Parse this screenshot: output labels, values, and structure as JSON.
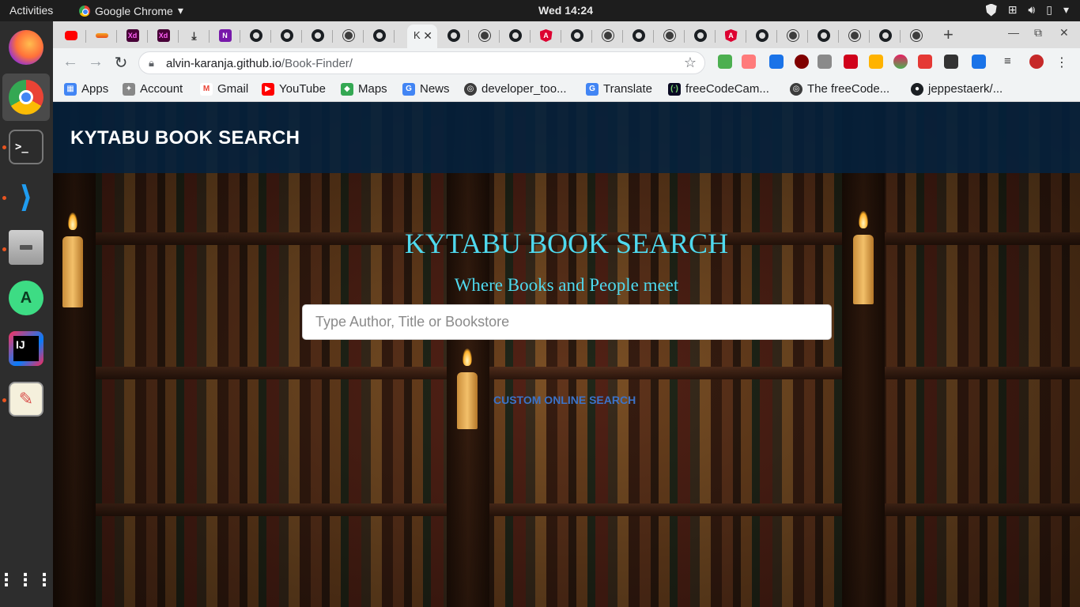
{
  "topbar": {
    "activities": "Activities",
    "app_name": "Google Chrome",
    "clock": "Wed 14:24"
  },
  "dock": {
    "apps": [
      "firefox",
      "chrome",
      "terminal",
      "vscode",
      "files",
      "android-studio",
      "intellij",
      "text-editor"
    ]
  },
  "browser": {
    "url_host": "alvin-karanja.github.io",
    "url_path": "/Book-Finder/",
    "active_tab_title": "K",
    "bookmarks": [
      {
        "label": "Apps",
        "icon": "apps-grid-icon",
        "color": "#4285f4"
      },
      {
        "label": "Account",
        "icon": "account-icon",
        "color": "#888888"
      },
      {
        "label": "Gmail",
        "icon": "gmail-icon",
        "color": "#ea4335"
      },
      {
        "label": "YouTube",
        "icon": "youtube-icon",
        "color": "#ff0000"
      },
      {
        "label": "Maps",
        "icon": "maps-icon",
        "color": "#34a853"
      },
      {
        "label": "News",
        "icon": "news-icon",
        "color": "#4285f4"
      },
      {
        "label": "developer_too...",
        "icon": "globe-icon",
        "color": "#3c3c3c"
      },
      {
        "label": "Translate",
        "icon": "translate-icon",
        "color": "#4285f4"
      },
      {
        "label": "freeCodeCam...",
        "icon": "freecodecamp-icon",
        "color": "#0a0a23"
      },
      {
        "label": "The freeCode...",
        "icon": "globe-icon",
        "color": "#3c3c3c"
      },
      {
        "label": "jeppestaerk/...",
        "icon": "github-icon",
        "color": "#1b1f23"
      }
    ]
  },
  "site": {
    "brand": "KYTABU BOOK SEARCH",
    "hero_title": "KYTABU BOOK SEARCH",
    "hero_subtitle": "Where Books and People meet",
    "search_placeholder": "Type Author, Title or Bookstore",
    "custom_search_link": "CUSTOM ONLINE SEARCH",
    "colors": {
      "navbar": "#032240",
      "hero_text": "#4fd9ee",
      "link": "#3c73c8"
    }
  }
}
